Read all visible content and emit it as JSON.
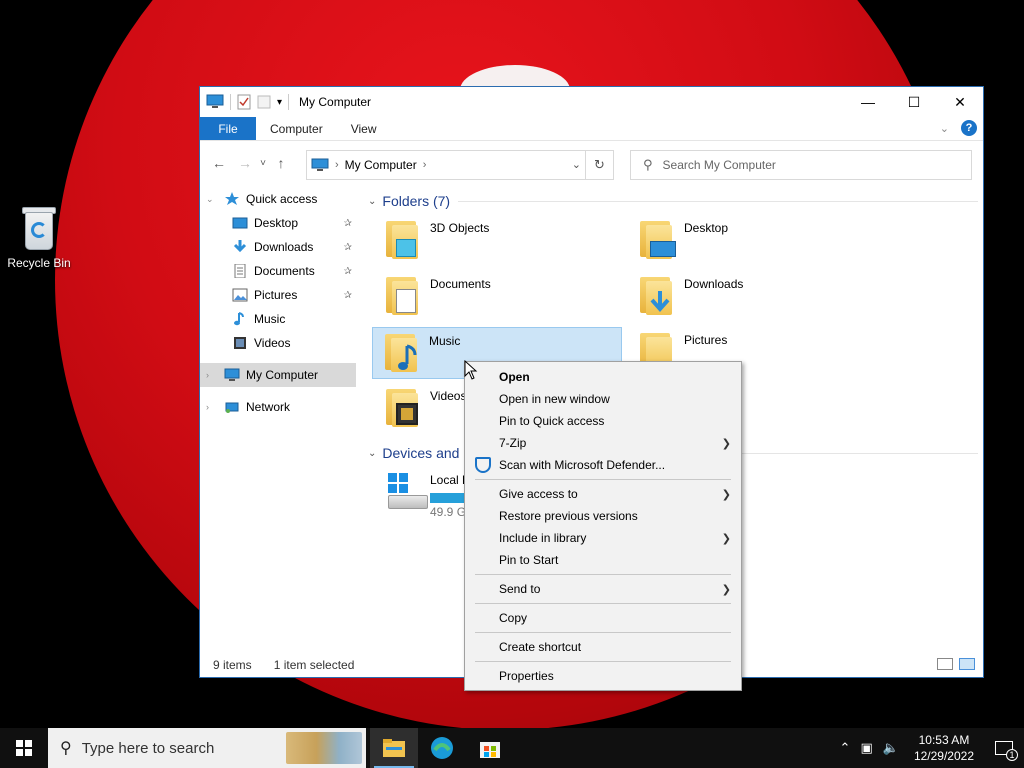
{
  "desktop": {
    "icons": [
      {
        "label": "Recycle Bin"
      }
    ]
  },
  "window": {
    "title": "My Computer",
    "controls": {
      "minimize": "—",
      "maximize": "☐",
      "close": "✕"
    }
  },
  "ribbon": {
    "tabs": [
      {
        "label": "File"
      },
      {
        "label": "Computer"
      },
      {
        "label": "View"
      }
    ],
    "help": "?"
  },
  "navigation": {
    "back": "←",
    "forward": "→",
    "recent": "˅",
    "up": "↑",
    "address": "My Computer",
    "refresh": "↻",
    "search_placeholder": "Search My Computer"
  },
  "sidebar": {
    "items": [
      {
        "label": "Quick access",
        "icon": "star-icon"
      },
      {
        "label": "Desktop",
        "icon": "desktop-icon",
        "pinned": true
      },
      {
        "label": "Downloads",
        "icon": "download-icon",
        "pinned": true
      },
      {
        "label": "Documents",
        "icon": "document-icon",
        "pinned": true
      },
      {
        "label": "Pictures",
        "icon": "pictures-icon",
        "pinned": true
      },
      {
        "label": "Music",
        "icon": "music-icon"
      },
      {
        "label": "Videos",
        "icon": "video-icon"
      },
      {
        "label": "My Computer",
        "icon": "computer-icon",
        "selected": true
      },
      {
        "label": "Network",
        "icon": "network-icon"
      }
    ]
  },
  "content": {
    "folders_header": "Folders (7)",
    "folders": [
      {
        "name": "3D Objects"
      },
      {
        "name": "Desktop"
      },
      {
        "name": "Documents"
      },
      {
        "name": "Downloads"
      },
      {
        "name": "Music",
        "selected": true
      },
      {
        "name": "Pictures"
      },
      {
        "name": "Videos"
      }
    ],
    "devices_header": "Devices and",
    "drives": [
      {
        "name": "Local D",
        "size": "49.9 GI",
        "extra": ":)"
      }
    ]
  },
  "status": {
    "item_count": "9 items",
    "selection": "1 item selected"
  },
  "context_menu": {
    "groups": [
      [
        {
          "label": "Open",
          "bold": true
        },
        {
          "label": "Open in new window"
        },
        {
          "label": "Pin to Quick access"
        },
        {
          "label": "7-Zip",
          "submenu": true
        },
        {
          "label": "Scan with Microsoft Defender...",
          "icon": "defender-shield-icon"
        }
      ],
      [
        {
          "label": "Give access to",
          "submenu": true
        },
        {
          "label": "Restore previous versions"
        },
        {
          "label": "Include in library",
          "submenu": true
        },
        {
          "label": "Pin to Start"
        }
      ],
      [
        {
          "label": "Send to",
          "submenu": true
        }
      ],
      [
        {
          "label": "Copy"
        }
      ],
      [
        {
          "label": "Create shortcut"
        }
      ],
      [
        {
          "label": "Properties"
        }
      ]
    ]
  },
  "taskbar": {
    "search_placeholder": "Type here to search",
    "clock_time": "10:53 AM",
    "clock_date": "12/29/2022",
    "notification_count": "1"
  }
}
